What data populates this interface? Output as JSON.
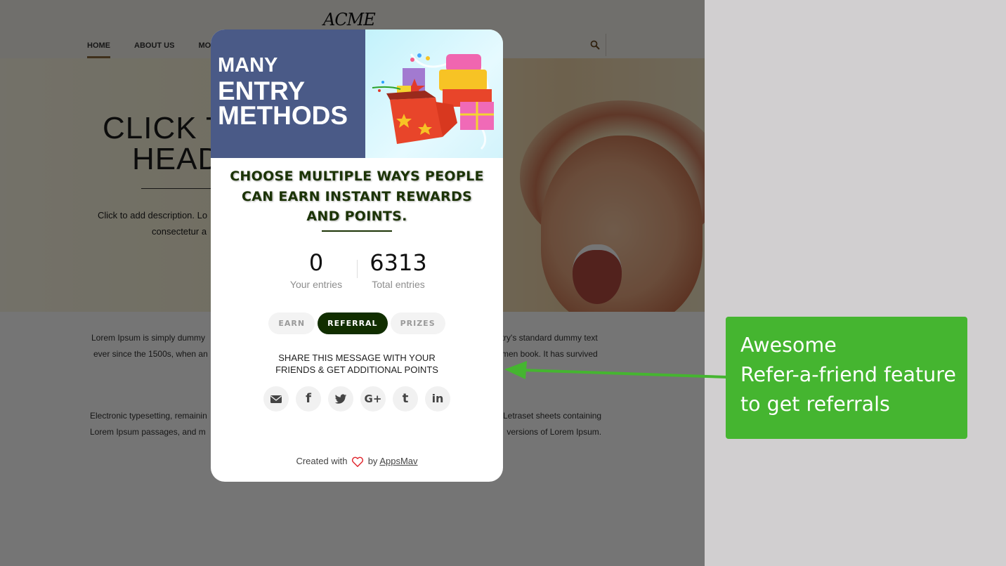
{
  "site": {
    "logo": "ACME",
    "nav": [
      {
        "label": "HOME",
        "active": true
      },
      {
        "label": "ABOUT US",
        "active": false
      },
      {
        "label": "MORE",
        "active": false
      }
    ],
    "search_icon": "search-icon",
    "hero": {
      "title_line1": "CLICK T",
      "title_line2": "HEAD",
      "desc_line1": "Click to add description. Lo",
      "desc_line2": "consectetur a"
    },
    "paragraphs": {
      "p1_left_line1": "Lorem Ipsum is simply dummy",
      "p1_left_line2": "ever since the 1500s, when an",
      "p1_right_line1": "try's standard dummy text",
      "p1_right_line2": "men book. It has survived",
      "p2_left_line1": "Electronic typesetting, remainin",
      "p2_left_line2": "Lorem Ipsum passages, and m",
      "p2_right_line1": "Letraset sheets containing",
      "p2_right_line2": "versions of Lorem Ipsum."
    }
  },
  "modal": {
    "banner": {
      "line1": "MANY",
      "line2": "ENTRY",
      "line3": "METHODS",
      "image": "gift-boxes-illustration"
    },
    "headline_line1": "CHOOSE MULTIPLE WAYS PEOPLE",
    "headline_line2": "CAN EARN INSTANT REWARDS",
    "headline_line3": "AND POINTS.",
    "stats": {
      "your_entries": {
        "value": "0",
        "label": "Your entries"
      },
      "total_entries": {
        "value": "6313",
        "label": "Total entries"
      }
    },
    "tabs": [
      {
        "label": "EARN",
        "active": false
      },
      {
        "label": "REFERRAL",
        "active": true
      },
      {
        "label": "PRIZES",
        "active": false
      }
    ],
    "share_text_line1": "SHARE THIS MESSAGE WITH YOUR",
    "share_text_line2": "FRIENDS & GET ADDITIONAL POINTS",
    "share_buttons": [
      {
        "icon": "email-icon",
        "glyph": ""
      },
      {
        "icon": "facebook-icon",
        "glyph": "f"
      },
      {
        "icon": "twitter-icon",
        "glyph": ""
      },
      {
        "icon": "google-plus-icon",
        "glyph": "G+"
      },
      {
        "icon": "tumblr-icon",
        "glyph": "t"
      },
      {
        "icon": "linkedin-icon",
        "glyph": "in"
      }
    ],
    "credit": {
      "prefix": "Created with",
      "by": "by",
      "brand": "AppsMav"
    }
  },
  "annotation": {
    "line1": "Awesome",
    "line2": "Refer-a-friend feature",
    "line3": "to get referrals",
    "color": "#45b530"
  }
}
